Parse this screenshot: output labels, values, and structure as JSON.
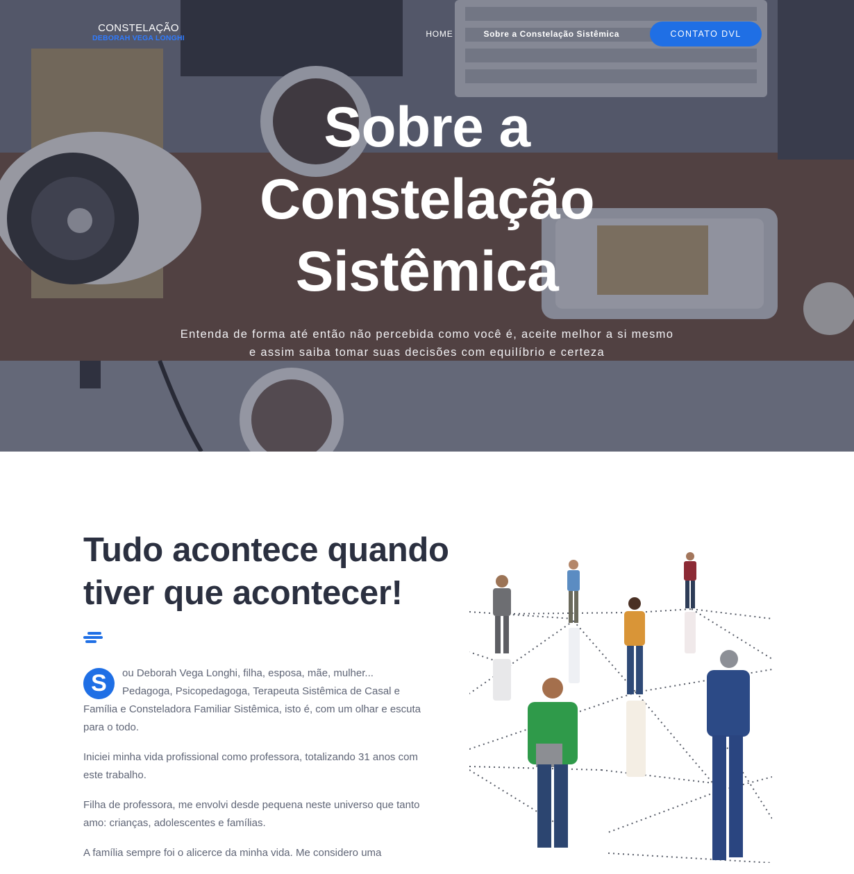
{
  "header": {
    "logo_line1": "CONSTELAÇÃO",
    "logo_line2": "DEBORAH VEGA LONGHI",
    "nav": {
      "home": "HOME",
      "sobre": "Sobre a Constelação Sistêmica",
      "contact_button": "CONTATO DVL"
    }
  },
  "hero": {
    "title_line1": "Sobre a",
    "title_line2": "Constelação",
    "title_line3": "Sistêmica",
    "subtitle_line1": "Entenda de forma até então não percebida como você é, aceite melhor a si mesmo",
    "subtitle_line2": "e assim saiba tomar suas decisões com equilíbrio e certeza"
  },
  "content": {
    "title_line1": "Tudo acontece quando",
    "title_line2": "tiver que acontecer!",
    "dropcap": "S",
    "paragraph1": "ou Deborah Vega Longhi, filha, esposa, mãe, mulher... Pedagoga, Psicopedagoga, Terapeuta Sistêmica de Casal e Família e Consteladora Familiar Sistêmica, isto é, com um olhar e escuta para o todo.",
    "paragraph2": "Iniciei minha vida profissional como professora, totalizando 31 anos com este trabalho.",
    "paragraph3": "Filha de professora, me envolvi desde pequena neste universo que tanto amo: crianças, adolescentes e famílias.",
    "paragraph4": "A família sempre foi o alicerce da minha vida. Me considero uma"
  },
  "colors": {
    "accent": "#1f6fe5",
    "heading": "#2b3040",
    "body": "#5f6576"
  }
}
